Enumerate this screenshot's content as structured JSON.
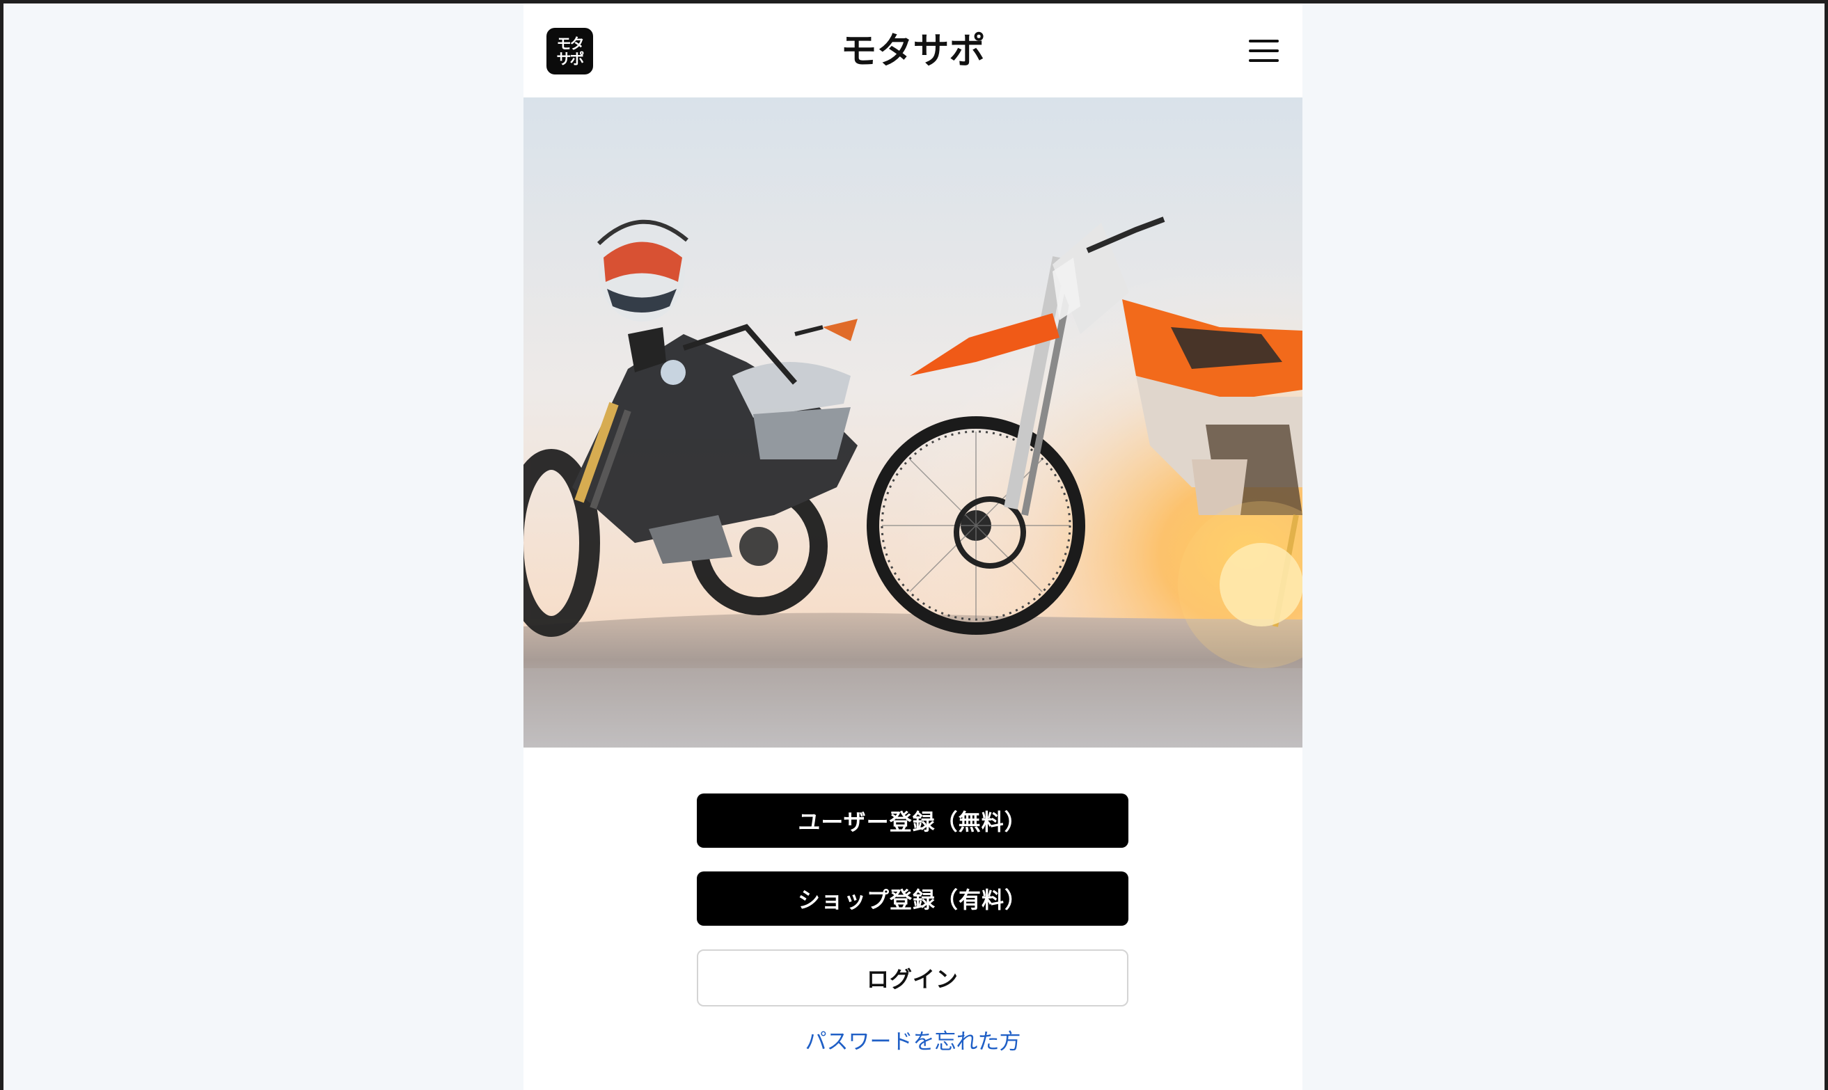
{
  "header": {
    "logo_line1": "モタ",
    "logo_line2": "サポ",
    "title": "モタサポ",
    "menu_icon": "hamburger-menu-icon"
  },
  "hero": {
    "image": "two off-road motorcycles on sand at sunset, helmet on left bike"
  },
  "actions": {
    "user_register": "ユーザー登録（無料）",
    "shop_register": "ショップ登録（有料）",
    "login": "ログイン",
    "forgot_password": "パスワードを忘れた方"
  },
  "colors": {
    "primary_button": "#000000",
    "link": "#1f5fc6",
    "page_background": "#f4f7fa"
  }
}
